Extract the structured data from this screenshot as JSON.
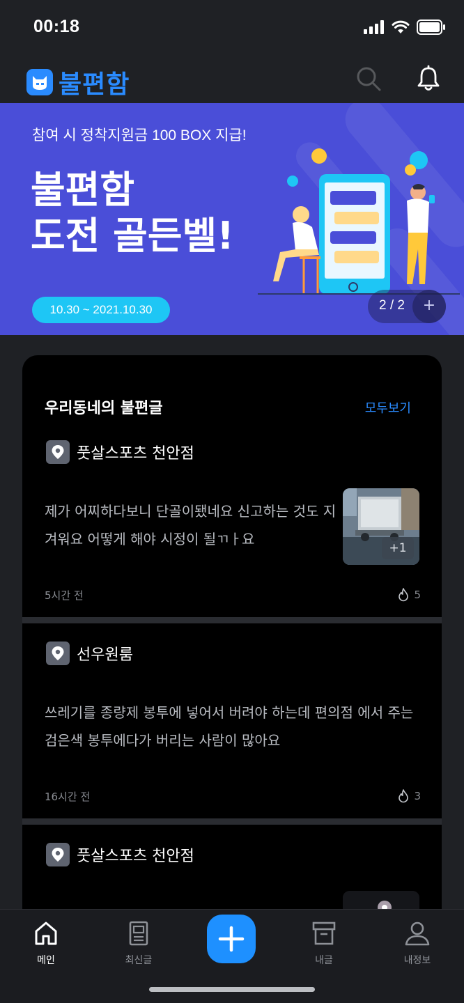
{
  "status_bar": {
    "time": "00:18"
  },
  "header": {
    "logo_text": "불편함",
    "icons": [
      "search-icon",
      "bell-icon"
    ]
  },
  "banner": {
    "subtitle": "참여 시 정착지원금 100 BOX 지급!",
    "title_line1": "불편함",
    "title_line2": "도전 골든벨!",
    "date_range": "10.30 ~ 2021.10.30",
    "pager": "2 / 2",
    "pager_more": "+"
  },
  "feed": {
    "section_title": "우리동네의 불편글",
    "see_all": "모두보기",
    "posts": [
      {
        "place": "풋살스포츠 천안점",
        "text": "제가 어찌하다보니 단골이됐네요 신고하는 것도 지겨워요 어떻게 해야 시정이 될ㄲㅏ요",
        "time": "5시간 전",
        "hot_count": "5",
        "thumb_more": "+1"
      },
      {
        "place": "선우원룸",
        "text": "쓰레기를 종량제 봉투에 넣어서 버려야 하는데 편의점 에서 주는 검은색 봉투에다가 버리는 사람이 많아요",
        "time": "16시간 전",
        "hot_count": "3"
      },
      {
        "place": "풋살스포츠 천안점"
      }
    ]
  },
  "tabbar": {
    "tabs": [
      {
        "label": "메인",
        "icon": "home-icon",
        "active": true
      },
      {
        "label": "최신글",
        "icon": "document-icon"
      },
      {
        "label": "",
        "icon": "plus-icon"
      },
      {
        "label": "내글",
        "icon": "archive-icon"
      },
      {
        "label": "내정보",
        "icon": "user-icon"
      }
    ]
  },
  "colors": {
    "accent": "#2a8bff",
    "banner_bg": "#4a4ed8",
    "date_pill": "#1ec6f5",
    "fab": "#1e90ff"
  }
}
